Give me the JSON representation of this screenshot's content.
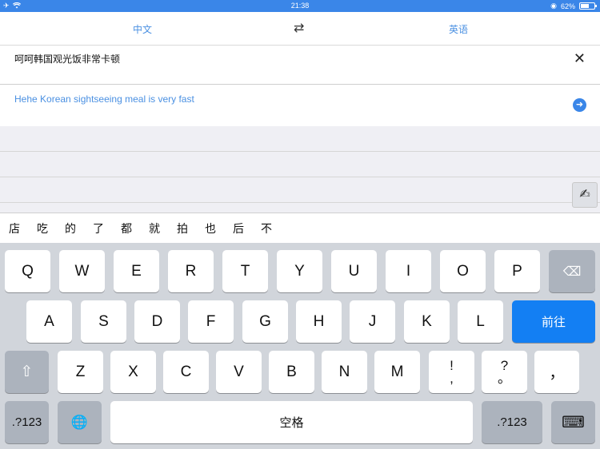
{
  "status": {
    "time": "21:38",
    "battery": "62%",
    "battery_level": 0.62
  },
  "lang": {
    "source": "中文",
    "swap": "⇄",
    "target": "英语"
  },
  "input": {
    "text": "呵呵韩国观光饭非常卡顿",
    "clear": "✕"
  },
  "output": {
    "text": "Hehe Korean sightseeing meal is very fast",
    "go": "➜"
  },
  "handwrite": "✍",
  "candidates": [
    "店",
    "吃",
    "的",
    "了",
    "都",
    "就",
    "拍",
    "也",
    "后",
    "不"
  ],
  "keyboard": {
    "row1": [
      "Q",
      "W",
      "E",
      "R",
      "T",
      "Y",
      "U",
      "I",
      "O",
      "P"
    ],
    "row2": [
      "A",
      "S",
      "D",
      "F",
      "G",
      "H",
      "J",
      "K",
      "L"
    ],
    "row3": [
      "Z",
      "X",
      "C",
      "V",
      "B",
      "N",
      "M"
    ],
    "punct1_top": "!",
    "punct1_bottom": ",",
    "punct2_top": "?",
    "punct2_bottom": "。",
    "punct3": "，",
    "backspace": "⌫",
    "go_label": "前往",
    "shift": "⇧",
    "num_label": ".?123",
    "globe": "🌐",
    "space_label": "空格",
    "hide": "⌨"
  }
}
